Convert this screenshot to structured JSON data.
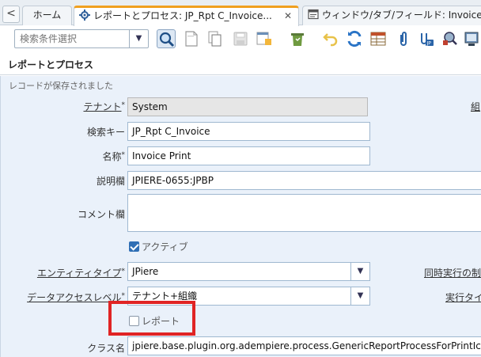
{
  "tabs": {
    "back_glyph": "<",
    "home": "ホーム",
    "active": "レポートとプロセス: JP_Rpt C_Invoice...",
    "active_close": "✕",
    "window": "ウィンドウ/タブ/フィールド: Invoice"
  },
  "toolbar": {
    "search_placeholder": "検索条件選択",
    "icons": [
      "search-icon",
      "new-record-icon",
      "copy-record-icon",
      "save-icon",
      "save-create-icon",
      "delete-icon",
      "undo-icon",
      "refresh-icon",
      "grid-toggle-icon",
      "attachment-icon",
      "chat-icon",
      "zoom-across-icon",
      "form-icon"
    ]
  },
  "header": {
    "title": "レポートとプロセス"
  },
  "form": {
    "status": "レコードが保存されました",
    "tenant": {
      "label": "テナント",
      "value": "System"
    },
    "search_key": {
      "label": "検索キー",
      "value": "JP_Rpt C_Invoice"
    },
    "name": {
      "label": "名称",
      "value": "Invoice Print"
    },
    "description": {
      "label": "説明欄",
      "value": "JPIERE-0655:JPBP"
    },
    "comment": {
      "label": "コメント欄",
      "value": ""
    },
    "active": {
      "label": "アクティブ",
      "checked": true
    },
    "entity_type": {
      "label": "エンティティタイプ",
      "value": "JPiere"
    },
    "data_access_level": {
      "label": "データアクセスレベル",
      "value": "テナント+組織"
    },
    "report": {
      "label": "レポート",
      "checked": false
    },
    "classname": {
      "label": "クラス名",
      "value": "jpiere.base.plugin.org.adempiere.process.GenericReportProcessForPrintIcon"
    },
    "right_labels": {
      "org": "組",
      "concurrent": "同時実行の制",
      "execution": "実行タイ"
    }
  },
  "colors": {
    "accent_tab": "#f0a020",
    "highlight_box": "#e02424",
    "form_bg": "#eaf1fa"
  }
}
